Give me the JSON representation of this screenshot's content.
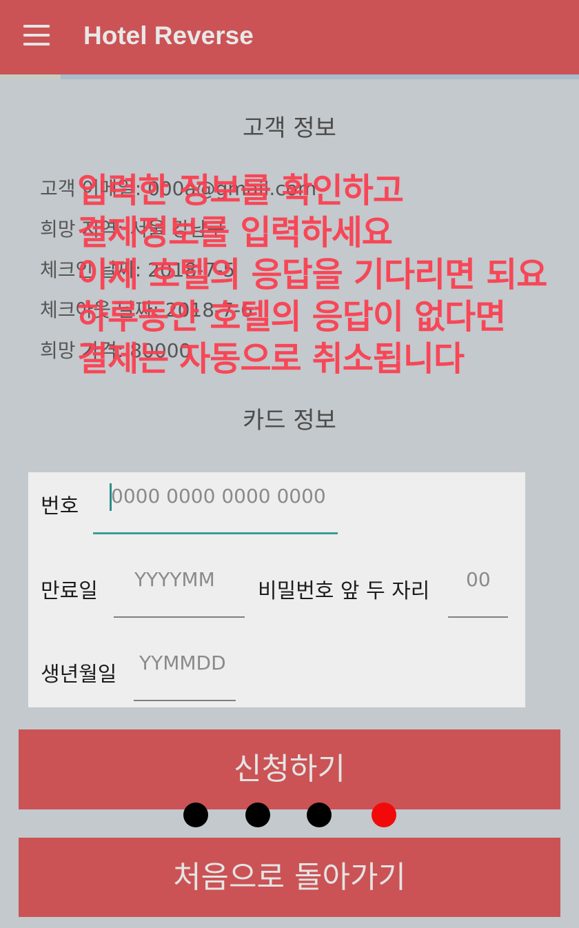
{
  "app": {
    "title": "Hotel Reverse",
    "menu_icon": "hamburger-menu-icon"
  },
  "customer_section": {
    "title": "고객 정보",
    "lines": [
      "고객 이메일: 000a@gmail.com",
      "희망 지역: 서울 강남구",
      "체크인 날짜: 2018-7-5",
      "체크아웃 날짜: 2018-7-6",
      "희망 가격: 80000"
    ]
  },
  "overlay_message": {
    "lines": [
      "입력한 정보를 확인하고",
      "결제정보를 입력하세요",
      "이제 호텔의 응답을 기다리면 되요",
      "하루동안 호텔의 응답이 없다면",
      "결제는 자동으로 취소됩니다"
    ],
    "color": "#fb3e4f"
  },
  "card_section": {
    "title": "카드 정보",
    "number_label": "번호",
    "number_placeholder": "0000 0000 0000 0000",
    "expiry_label": "만료일",
    "expiry_placeholder": "YYYYMM",
    "password_label": "비밀번호 앞 두 자리",
    "password_placeholder": "00",
    "birth_label": "생년월일",
    "birth_placeholder": "YYMMDD"
  },
  "buttons": {
    "apply": "신청하기",
    "home": "처음으로 돌아가기"
  },
  "page_indicator": {
    "count": 4,
    "active_index": 3,
    "active_color": "#f20a0a"
  },
  "colors": {
    "primary": "#cb5355",
    "background": "#c3c9cd",
    "accent": "#3a9e97"
  }
}
